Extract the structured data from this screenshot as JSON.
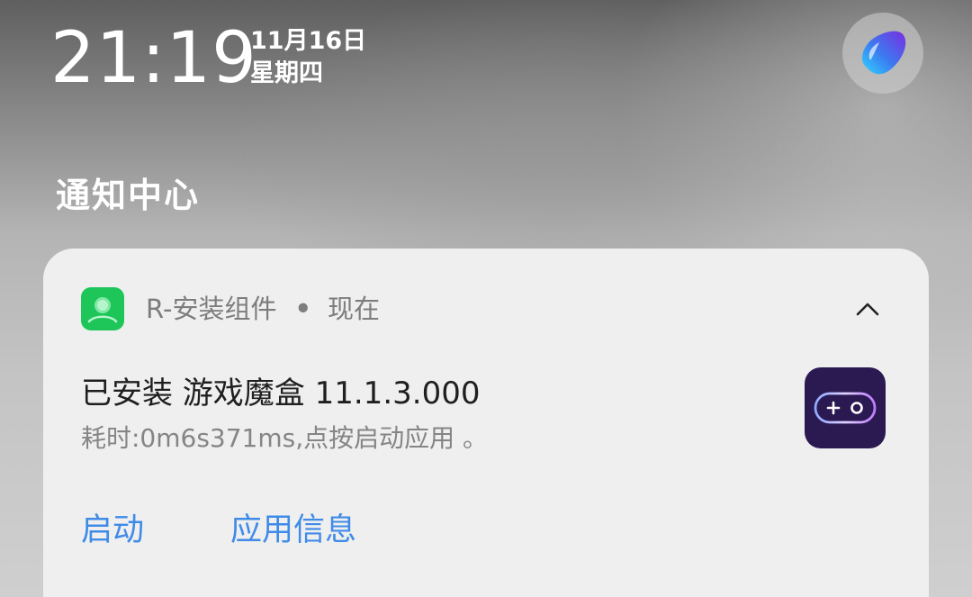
{
  "status": {
    "time": "21:19",
    "date": "11月16日",
    "weekday": "星期四"
  },
  "notification_center": {
    "title": "通知中心"
  },
  "notification": {
    "app_name": "R-安装组件",
    "separator": "•",
    "timestamp": "现在",
    "title": "已安装  游戏魔盒  11.1.3.000",
    "body": "耗时:0m6s371ms,点按启动应用 。",
    "actions": {
      "launch": "启动",
      "app_info": "应用信息"
    },
    "app_icon": "installer-icon",
    "large_icon": "game-box-icon",
    "collapse_icon": "chevron-up-icon"
  },
  "colors": {
    "accent": "#3f8be8",
    "installer_green": "#1ec65a",
    "game_box_bg": "#2b1a52"
  }
}
